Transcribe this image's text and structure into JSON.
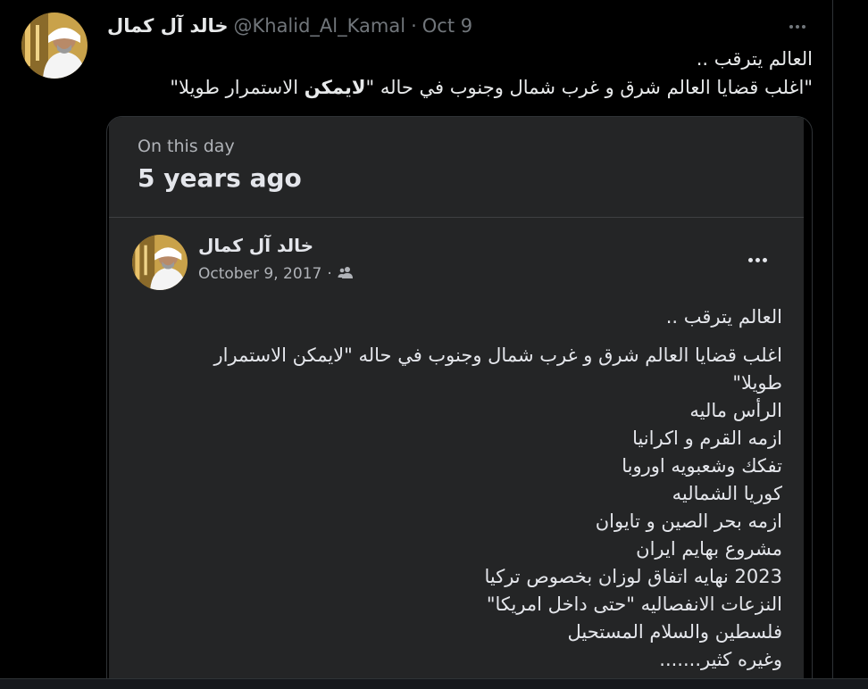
{
  "tweet": {
    "author_name": "خالد آل كمال",
    "handle": "@Khalid_Al_Kamal",
    "separator": "·",
    "date": "Oct 9",
    "line1": "العالم يترقب ..",
    "line2_before": "\"اغلب قضايا العالم شرق و غرب شمال وجنوب في حاله \"",
    "line2_bold": "لايمكن",
    "line2_after": " الاستمرار طويلا\""
  },
  "card": {
    "on_this_day": "On this day",
    "years_ago": "5 years ago",
    "post": {
      "author_name": "خالد آل كمال",
      "date": "October 9, 2017",
      "separator": "·",
      "audience_icon": "friends-icon",
      "lines": [
        "العالم يترقب ..",
        "اغلب قضايا العالم شرق و غرب شمال وجنوب في حاله \"لايمكن الاستمرار طويلا\"",
        "الرأس ماليه",
        "ازمه القرم و اكرانيا",
        "تفكك وشعبويه اوروبا",
        "كوريا الشماليه",
        "ازمه بحر الصين و تايوان",
        "مشروع بهايم ايران",
        "2023 نهايه اتفاق لوزان بخصوص تركيا",
        "النزعات الانفصاليه \"حتى داخل امريكا\"",
        "فلسطين والسلام المستحيل",
        "وغيره كثير......."
      ]
    }
  },
  "colors": {
    "background": "#000000",
    "text_primary": "#e7e9ea",
    "text_secondary": "#71767b",
    "card_background": "#242526"
  }
}
